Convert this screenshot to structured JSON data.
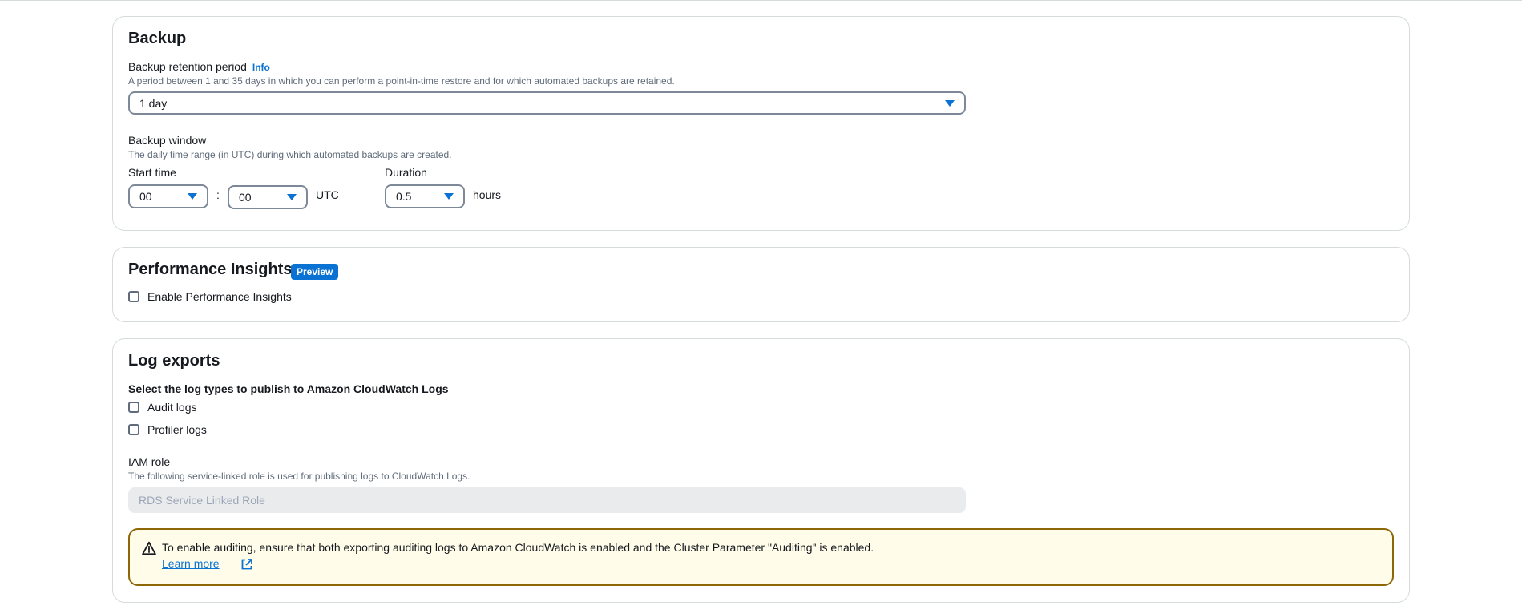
{
  "backup": {
    "title": "Backup",
    "retention": {
      "label": "Backup retention period",
      "info": "Info",
      "description": "A period between 1 and 35 days in which you can perform a point-in-time restore and for which automated backups are retained.",
      "value": "1 day"
    },
    "window": {
      "label": "Backup window",
      "description": "The daily time range (in UTC) during which automated backups are created.",
      "start_time_label": "Start time",
      "hour": "00",
      "separator": ":",
      "minute": "00",
      "timezone": "UTC",
      "duration_label": "Duration",
      "duration": "0.5",
      "duration_unit": "hours"
    }
  },
  "performance_insights": {
    "title": "Performance Insights",
    "badge": "Preview",
    "enable_label": "Enable Performance Insights",
    "enabled": false
  },
  "log_exports": {
    "title": "Log exports",
    "select_label": "Select the log types to publish to Amazon CloudWatch Logs",
    "options": [
      {
        "label": "Audit logs",
        "checked": false
      },
      {
        "label": "Profiler logs",
        "checked": false
      }
    ],
    "iam_role": {
      "label": "IAM role",
      "description": "The following service-linked role is used for publishing logs to CloudWatch Logs.",
      "value": "RDS Service Linked Role"
    },
    "alert": {
      "message": "To enable auditing, ensure that both exporting auditing logs to Amazon CloudWatch is enabled and the Cluster Parameter \"Auditing\" is enabled.",
      "link": "Learn more"
    }
  },
  "colors": {
    "accent": "#0972d3",
    "warning_border": "#8d6605",
    "warning_bg": "#fffce9"
  }
}
